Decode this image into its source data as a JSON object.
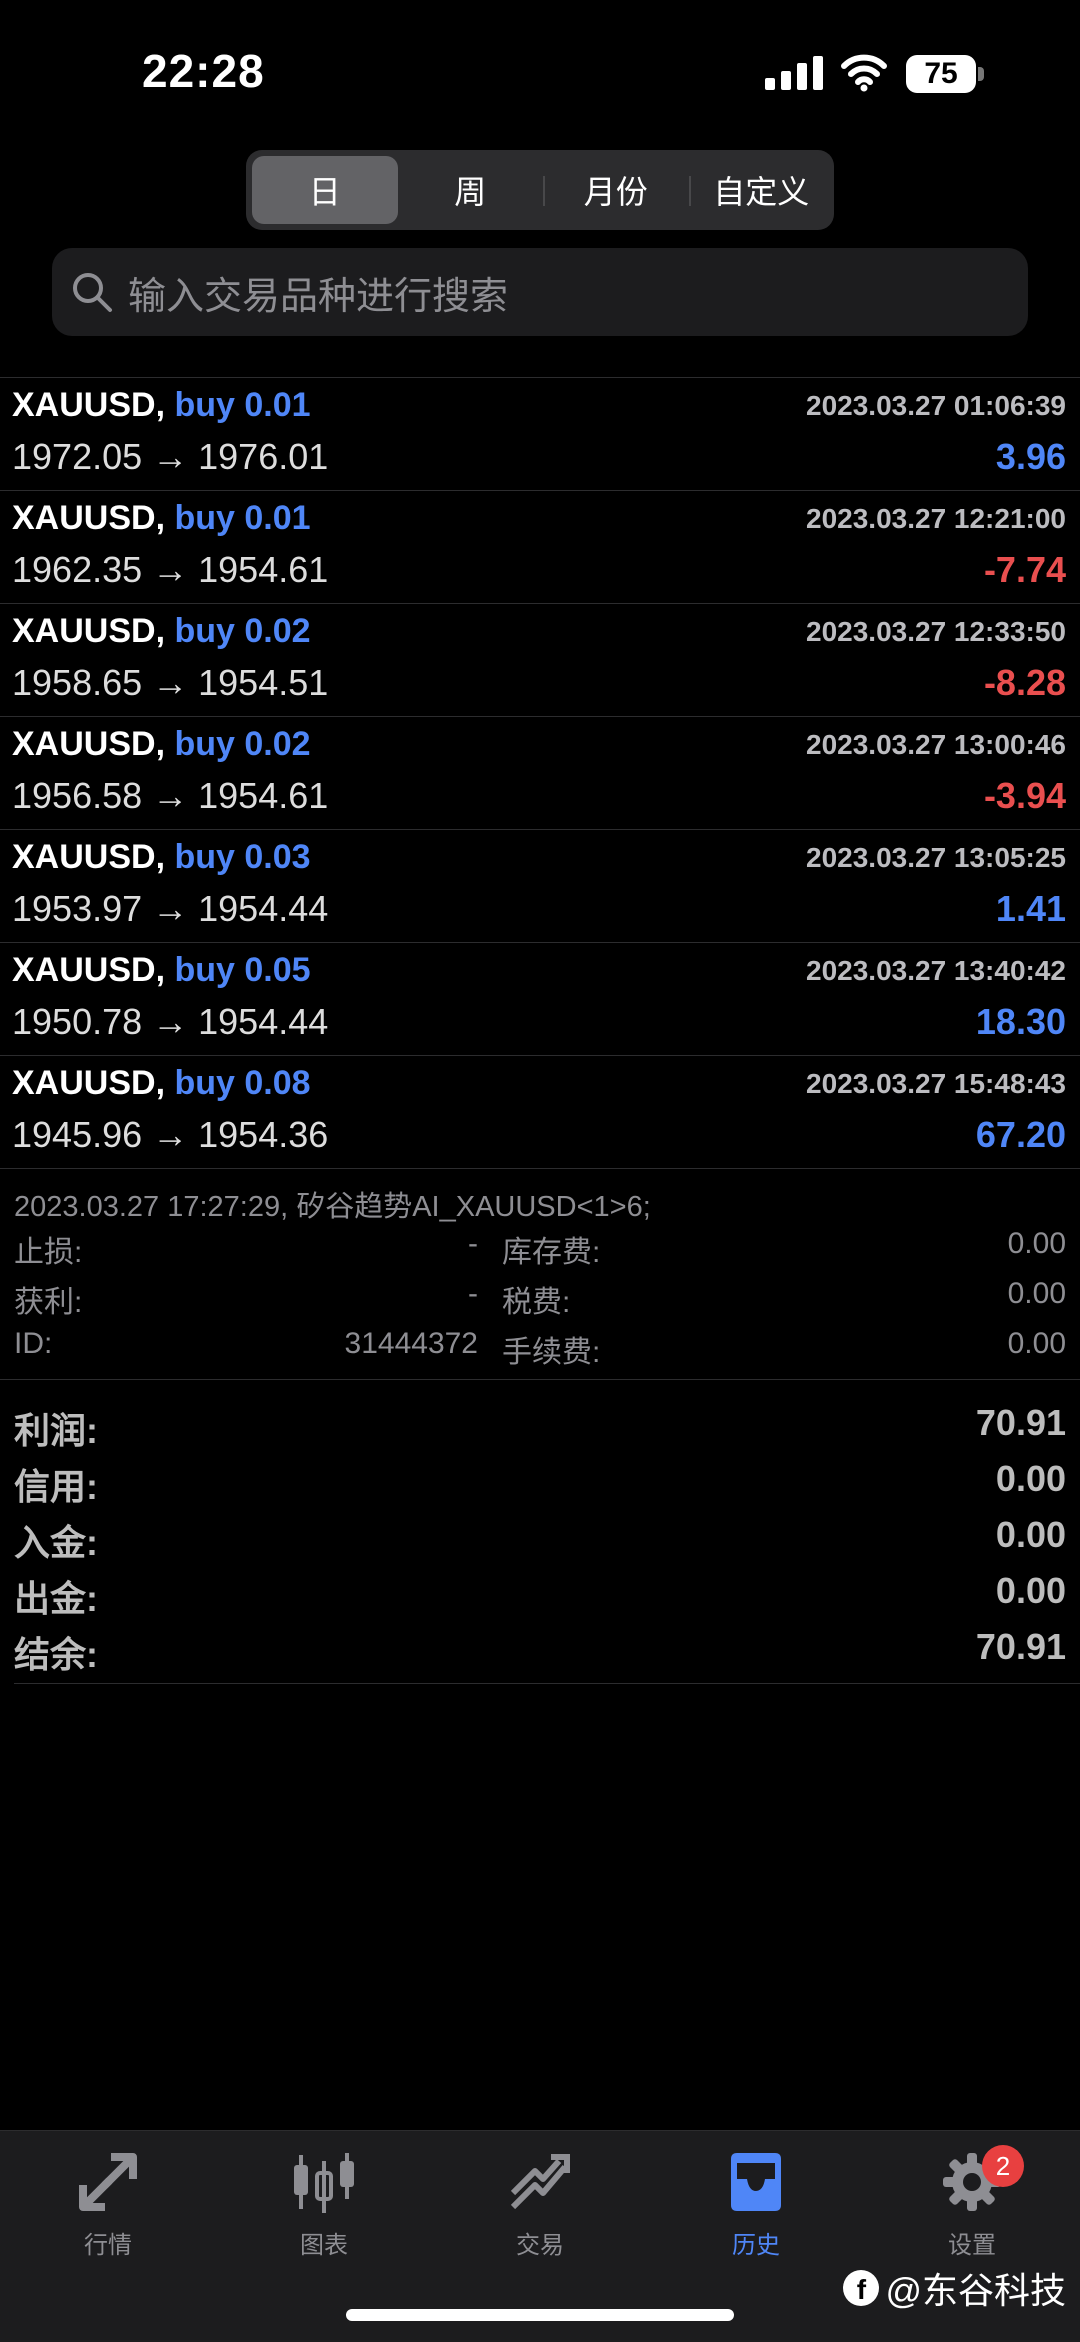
{
  "status_bar": {
    "time": "22:28",
    "battery": "75"
  },
  "segmented": [
    "日",
    "周",
    "月份",
    "自定义"
  ],
  "search": {
    "placeholder": "输入交易品种进行搜索"
  },
  "trades": [
    {
      "symbol": "XAUUSD,",
      "side": "buy 0.01",
      "datetime": "2023.03.27 01:06:39",
      "prices": "1972.05 → 1976.01",
      "profit": "3.96",
      "sign": "pos"
    },
    {
      "symbol": "XAUUSD,",
      "side": "buy 0.01",
      "datetime": "2023.03.27 12:21:00",
      "prices": "1962.35 → 1954.61",
      "profit": "-7.74",
      "sign": "neg"
    },
    {
      "symbol": "XAUUSD,",
      "side": "buy 0.02",
      "datetime": "2023.03.27 12:33:50",
      "prices": "1958.65 → 1954.51",
      "profit": "-8.28",
      "sign": "neg"
    },
    {
      "symbol": "XAUUSD,",
      "side": "buy 0.02",
      "datetime": "2023.03.27 13:00:46",
      "prices": "1956.58 → 1954.61",
      "profit": "-3.94",
      "sign": "neg"
    },
    {
      "symbol": "XAUUSD,",
      "side": "buy 0.03",
      "datetime": "2023.03.27 13:05:25",
      "prices": "1953.97 → 1954.44",
      "profit": "1.41",
      "sign": "pos"
    },
    {
      "symbol": "XAUUSD,",
      "side": "buy 0.05",
      "datetime": "2023.03.27 13:40:42",
      "prices": "1950.78 → 1954.44",
      "profit": "18.30",
      "sign": "pos"
    },
    {
      "symbol": "XAUUSD,",
      "side": "buy 0.08",
      "datetime": "2023.03.27 15:48:43",
      "prices": "1945.96 → 1954.36",
      "profit": "67.20",
      "sign": "pos"
    }
  ],
  "detail": {
    "comment": "2023.03.27 17:27:29, 矽谷趋势AI_XAUUSD<1>6;",
    "rows": [
      {
        "label1": "止损:",
        "value1": "-",
        "label2": "库存费:",
        "value2": "0.00"
      },
      {
        "label1": "获利:",
        "value1": "-",
        "label2": "税费:",
        "value2": "0.00"
      },
      {
        "label1": "ID:",
        "value1": "31444372",
        "label2": "手续费:",
        "value2": "0.00"
      }
    ]
  },
  "summary": [
    {
      "label": "利润:",
      "value": "70.91"
    },
    {
      "label": "信用:",
      "value": "0.00"
    },
    {
      "label": "入金:",
      "value": "0.00"
    },
    {
      "label": "出金:",
      "value": "0.00"
    },
    {
      "label": "结余:",
      "value": "70.91"
    }
  ],
  "tabbar": {
    "items": [
      {
        "label": "行情",
        "icon": "quotes-arrows-icon"
      },
      {
        "label": "图表",
        "icon": "candlestick-chart-icon"
      },
      {
        "label": "交易",
        "icon": "trade-trend-icon"
      },
      {
        "label": "历史",
        "icon": "history-inbox-icon"
      },
      {
        "label": "设置",
        "icon": "gear-icon"
      }
    ],
    "active": "历史",
    "settings_badge": "2"
  },
  "watermark": "@东谷科技",
  "colors": {
    "accent": "#4f86f7",
    "negative": "#e94f4f",
    "background": "#000000"
  }
}
